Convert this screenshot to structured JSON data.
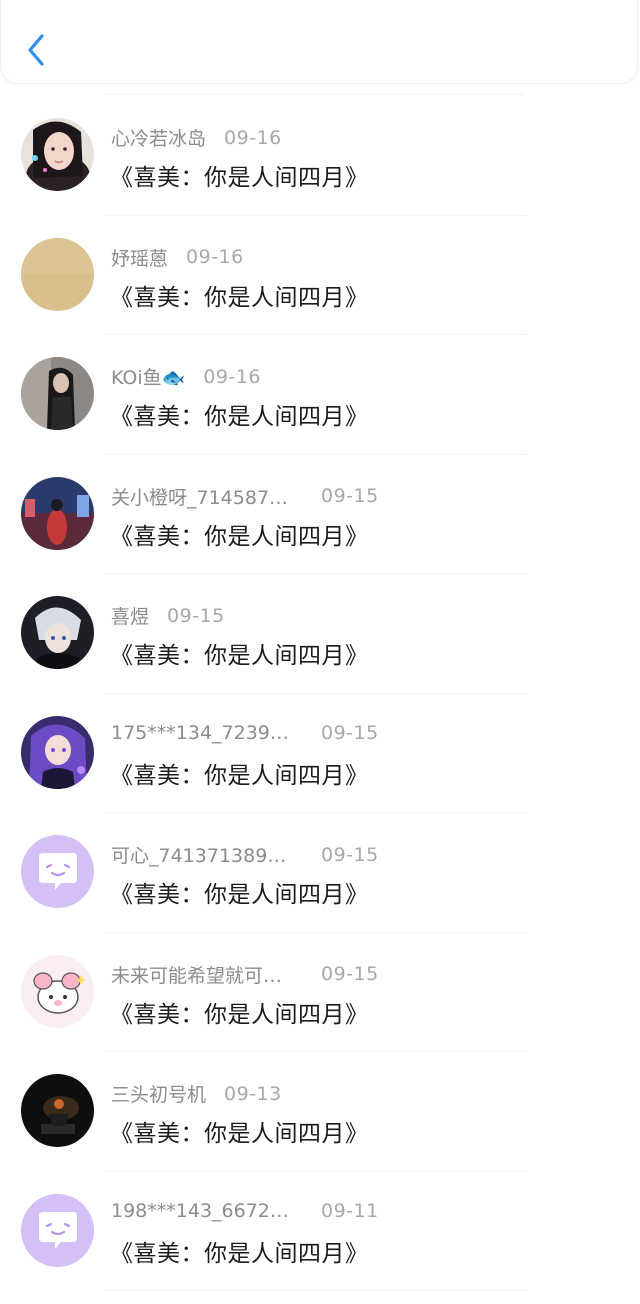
{
  "header": {
    "back_icon": "chevron-left-icon",
    "accent": "#2f8ef5"
  },
  "comments": [
    {
      "name": "心冷若冰岛",
      "date": "09-16",
      "title": "《喜美：你是人间四月》",
      "avatar": "photo-girl-selfie"
    },
    {
      "name": "妤瑶蒽",
      "date": "09-16",
      "title": "《喜美：你是人间四月》",
      "avatar": "solid-tan"
    },
    {
      "name": "KOi鱼🐟",
      "date": "09-16",
      "title": "《喜美：你是人间四月》",
      "avatar": "photo-dark-portrait"
    },
    {
      "name": "关小橙呀_714587…",
      "date": "09-15",
      "title": "《喜美：你是人间四月》",
      "avatar": "photo-night-city"
    },
    {
      "name": "喜煜",
      "date": "09-15",
      "title": "《喜美：你是人间四月》",
      "avatar": "anime-boy-dark"
    },
    {
      "name": "175***134_7239…",
      "date": "09-15",
      "title": "《喜美：你是人间四月》",
      "avatar": "anime-girl-purple"
    },
    {
      "name": "可心_741371389…",
      "date": "09-15",
      "title": "《喜美：你是人间四月》",
      "avatar": "default-chat-bubble"
    },
    {
      "name": "未来可能希望就可…",
      "date": "09-15",
      "title": "《喜美：你是人间四月》",
      "avatar": "cartoon-pink"
    },
    {
      "name": "三头初号机",
      "date": "09-13",
      "title": "《喜美：你是人间四月》",
      "avatar": "photo-dark-scene"
    },
    {
      "name": "198***143_6672…",
      "date": "09-11",
      "title": "《喜美：你是人间四月》",
      "avatar": "default-chat-bubble"
    }
  ]
}
